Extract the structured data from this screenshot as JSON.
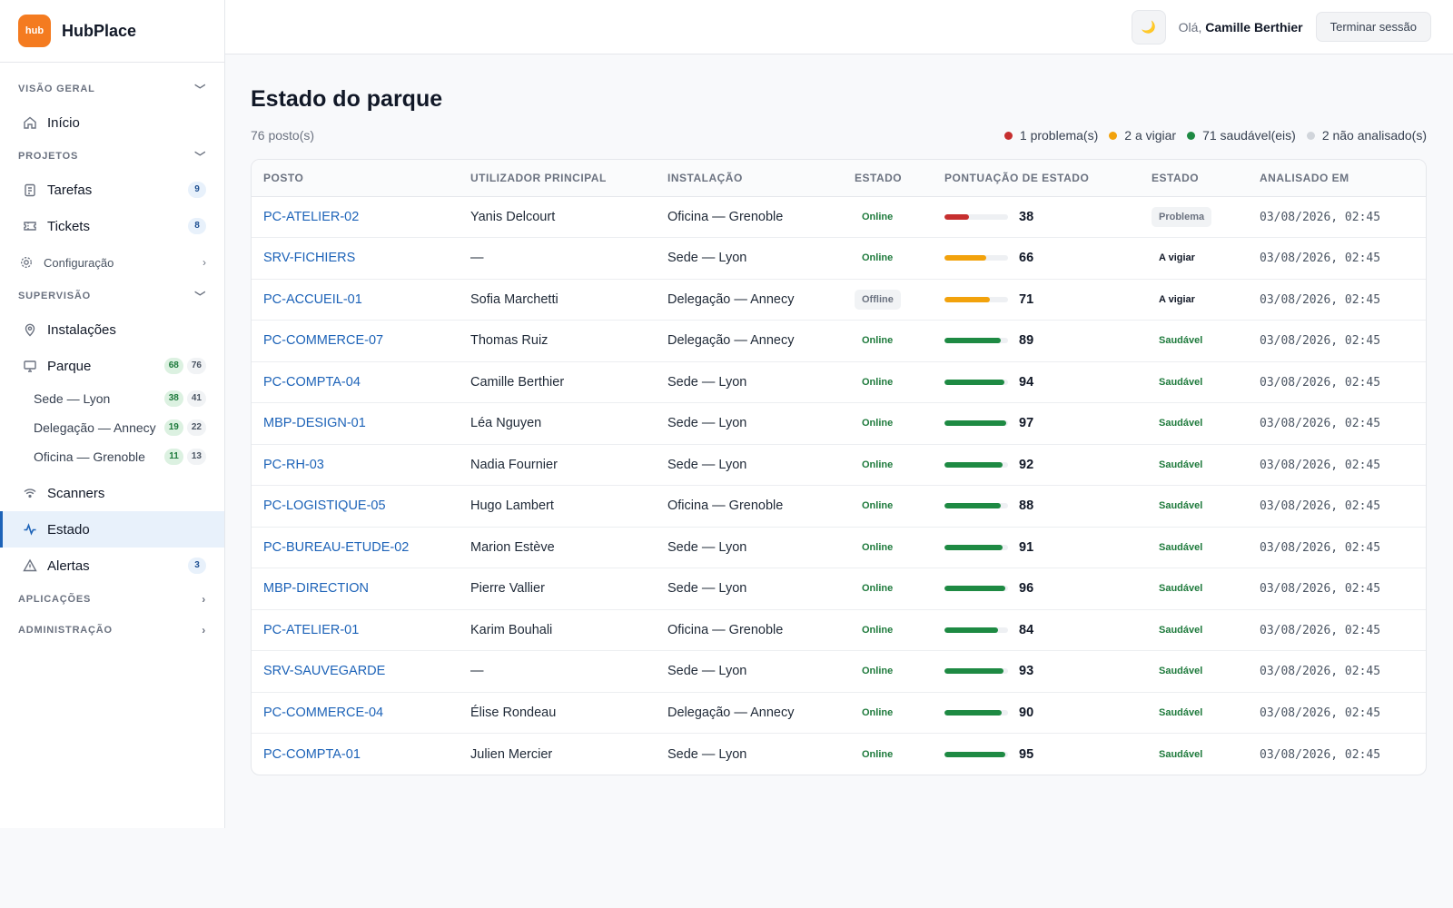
{
  "app": {
    "logo_text": "hub",
    "name": "HubPlace"
  },
  "sidebar": {
    "sections": {
      "overview": "VISÃO GERAL",
      "projects": "PROJETOS",
      "supervision": "SUPERVISÃO",
      "applications": "APLICAÇÕES",
      "administration": "ADMINISTRAÇÃO"
    },
    "items": {
      "home": {
        "label": "Início"
      },
      "tasks": {
        "label": "Tarefas",
        "badge": "9"
      },
      "tickets": {
        "label": "Tickets",
        "badge": "8"
      },
      "config": {
        "label": "Configuração"
      },
      "installations": {
        "label": "Instalações"
      },
      "park": {
        "label": "Parque",
        "badge_green": "68",
        "badge_grey": "76"
      },
      "scanners": {
        "label": "Scanners"
      },
      "status": {
        "label": "Estado"
      },
      "alerts": {
        "label": "Alertas",
        "badge": "3"
      }
    },
    "park_sites": [
      {
        "label": "Sede — Lyon",
        "green": "38",
        "grey": "41"
      },
      {
        "label": "Delegação — Annecy",
        "green": "19",
        "grey": "22"
      },
      {
        "label": "Oficina — Grenoble",
        "green": "11",
        "grey": "13"
      }
    ]
  },
  "topbar": {
    "theme_icon": "moon-icon",
    "greeting": "Olá,",
    "user_name": "Camille Berthier",
    "logout_label": "Terminar sessão"
  },
  "page": {
    "title": "Estado do parque",
    "count": "76 posto(s)",
    "legend": [
      {
        "label": "1 problema(s)",
        "color": "#c62f2f"
      },
      {
        "label": "2 a vigiar",
        "color": "#f2a20c"
      },
      {
        "label": "71 saudável(eis)",
        "color": "#1e8a43"
      },
      {
        "label": "2 não analisado(s)",
        "color": "#d1d5db"
      }
    ]
  },
  "table": {
    "columns": [
      "POSTO",
      "UTILIZADOR PRINCIPAL",
      "INSTALAÇÃO",
      "ESTADO",
      "PONTUAÇÃO DE ESTADO",
      "ESTADO",
      "ANALISADO EM"
    ],
    "rows": [
      {
        "host": "PC-ATELIER-02",
        "user": "Yanis Delcourt",
        "site": "Oficina — Grenoble",
        "conn": "Online",
        "score": 38,
        "health": "Problema",
        "analyzed": "03/08/2026, 02:45"
      },
      {
        "host": "SRV-FICHIERS",
        "user": "—",
        "site": "Sede — Lyon",
        "conn": "Online",
        "score": 66,
        "health": "A vigiar",
        "analyzed": "03/08/2026, 02:45"
      },
      {
        "host": "PC-ACCUEIL-01",
        "user": "Sofia Marchetti",
        "site": "Delegação — Annecy",
        "conn": "Offline",
        "score": 71,
        "health": "A vigiar",
        "analyzed": "03/08/2026, 02:45"
      },
      {
        "host": "PC-COMMERCE-07",
        "user": "Thomas Ruiz",
        "site": "Delegação — Annecy",
        "conn": "Online",
        "score": 89,
        "health": "Saudável",
        "analyzed": "03/08/2026, 02:45"
      },
      {
        "host": "PC-COMPTA-04",
        "user": "Camille Berthier",
        "site": "Sede — Lyon",
        "conn": "Online",
        "score": 94,
        "health": "Saudável",
        "analyzed": "03/08/2026, 02:45"
      },
      {
        "host": "MBP-DESIGN-01",
        "user": "Léa Nguyen",
        "site": "Sede — Lyon",
        "conn": "Online",
        "score": 97,
        "health": "Saudável",
        "analyzed": "03/08/2026, 02:45"
      },
      {
        "host": "PC-RH-03",
        "user": "Nadia Fournier",
        "site": "Sede — Lyon",
        "conn": "Online",
        "score": 92,
        "health": "Saudável",
        "analyzed": "03/08/2026, 02:45"
      },
      {
        "host": "PC-LOGISTIQUE-05",
        "user": "Hugo Lambert",
        "site": "Oficina — Grenoble",
        "conn": "Online",
        "score": 88,
        "health": "Saudável",
        "analyzed": "03/08/2026, 02:45"
      },
      {
        "host": "PC-BUREAU-ETUDE-02",
        "user": "Marion Estève",
        "site": "Sede — Lyon",
        "conn": "Online",
        "score": 91,
        "health": "Saudável",
        "analyzed": "03/08/2026, 02:45"
      },
      {
        "host": "MBP-DIRECTION",
        "user": "Pierre Vallier",
        "site": "Sede — Lyon",
        "conn": "Online",
        "score": 96,
        "health": "Saudável",
        "analyzed": "03/08/2026, 02:45"
      },
      {
        "host": "PC-ATELIER-01",
        "user": "Karim Bouhali",
        "site": "Oficina — Grenoble",
        "conn": "Online",
        "score": 84,
        "health": "Saudável",
        "analyzed": "03/08/2026, 02:45"
      },
      {
        "host": "SRV-SAUVEGARDE",
        "user": "—",
        "site": "Sede — Lyon",
        "conn": "Online",
        "score": 93,
        "health": "Saudável",
        "analyzed": "03/08/2026, 02:45"
      },
      {
        "host": "PC-COMMERCE-04",
        "user": "Élise Rondeau",
        "site": "Delegação — Annecy",
        "conn": "Online",
        "score": 90,
        "health": "Saudável",
        "analyzed": "03/08/2026, 02:45"
      },
      {
        "host": "PC-COMPTA-01",
        "user": "Julien Mercier",
        "site": "Sede — Lyon",
        "conn": "Online",
        "score": 95,
        "health": "Saudável",
        "analyzed": "03/08/2026, 02:45"
      }
    ]
  },
  "colors": {
    "accent": "#1d63b8",
    "brand": "#f47b20",
    "score_problem": "#c62f2f",
    "score_watch": "#f2a20c",
    "score_healthy": "#1e8a43"
  }
}
